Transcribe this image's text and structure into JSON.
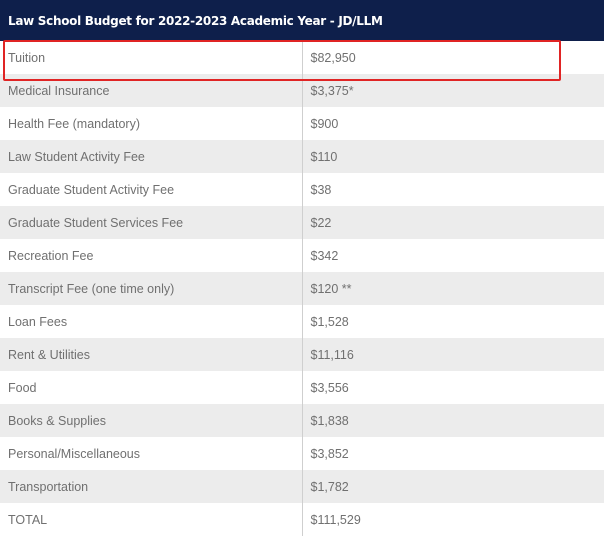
{
  "table": {
    "title": "Law School Budget for 2022-2023 Academic Year - JD/LLM",
    "rows": [
      {
        "label": "Tuition",
        "amount": "$82,950"
      },
      {
        "label": "Medical Insurance",
        "amount": "$3,375*"
      },
      {
        "label": "Health Fee (mandatory)",
        "amount": "$900"
      },
      {
        "label": "Law Student Activity Fee",
        "amount": "$110"
      },
      {
        "label": "Graduate Student Activity Fee",
        "amount": "$38"
      },
      {
        "label": "Graduate Student Services Fee",
        "amount": "$22"
      },
      {
        "label": "Recreation Fee",
        "amount": "$342"
      },
      {
        "label": "Transcript Fee (one time only)",
        "amount": "$120 **"
      },
      {
        "label": "Loan Fees",
        "amount": "$1,528"
      },
      {
        "label": "Rent & Utilities",
        "amount": "$11,116"
      },
      {
        "label": "Food",
        "amount": "$3,556"
      },
      {
        "label": "Books & Supplies",
        "amount": "$1,838"
      },
      {
        "label": "Personal/Miscellaneous",
        "amount": "$3,852"
      },
      {
        "label": "Transportation",
        "amount": "$1,782"
      },
      {
        "label": "TOTAL",
        "amount": "$111,529"
      }
    ]
  },
  "colors": {
    "header_background": "#0e1f4b",
    "highlight": "#e02424",
    "stripe": "#ececec"
  }
}
